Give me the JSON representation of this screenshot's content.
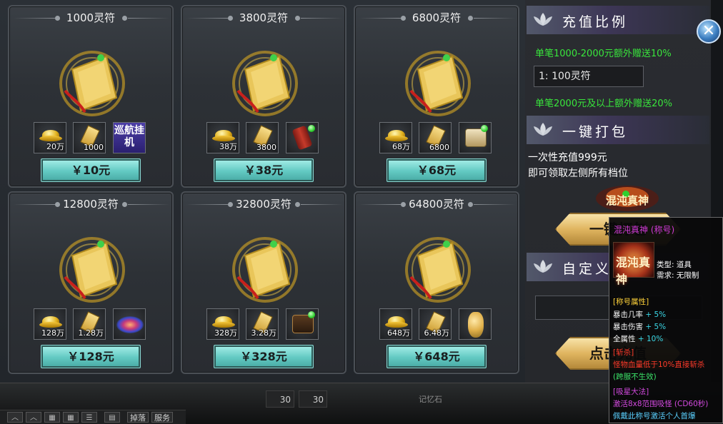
{
  "packs": [
    {
      "title": "1000灵符",
      "items": [
        {
          "icon": "gold-ingot",
          "count": "20万"
        },
        {
          "icon": "talisman-ticket",
          "count": "1000"
        },
        {
          "icon": "patrol-afk",
          "label": "巡航挂机"
        }
      ],
      "price": "￥10元"
    },
    {
      "title": "3800灵符",
      "items": [
        {
          "icon": "gold-ingot",
          "count": "38万"
        },
        {
          "icon": "talisman-ticket",
          "count": "3800"
        },
        {
          "icon": "red-scroll",
          "count": ""
        }
      ],
      "price": "￥38元"
    },
    {
      "title": "6800灵符",
      "items": [
        {
          "icon": "gold-ingot",
          "count": "68万"
        },
        {
          "icon": "talisman-ticket",
          "count": "6800"
        },
        {
          "icon": "treasure-chest",
          "count": ""
        }
      ],
      "price": "￥68元"
    },
    {
      "title": "12800灵符",
      "items": [
        {
          "icon": "gold-ingot",
          "count": "128万"
        },
        {
          "icon": "talisman-ticket",
          "count": "1.28万"
        },
        {
          "icon": "galaxy-effect",
          "count": ""
        }
      ],
      "price": "￥128元"
    },
    {
      "title": "32800灵符",
      "items": [
        {
          "icon": "gold-ingot",
          "count": "328万"
        },
        {
          "icon": "talisman-ticket",
          "count": "3.28万"
        },
        {
          "icon": "dark-chest",
          "count": ""
        }
      ],
      "price": "￥328元"
    },
    {
      "title": "64800灵符",
      "items": [
        {
          "icon": "gold-ingot",
          "count": "648万"
        },
        {
          "icon": "talisman-ticket",
          "count": "6.48万"
        },
        {
          "icon": "gourd-pet",
          "count": ""
        }
      ],
      "price": "￥648元"
    }
  ],
  "side": {
    "ratio_title": "充值比例",
    "bonus1": "单笔1000-2000元额外赠送10%",
    "rate_value": "1: 100灵符",
    "bonus2": "单笔2000元及以上额外赠送20%",
    "bundle_title": "一键打包",
    "bundle_desc1": "一次性充值999元",
    "bundle_desc2": "即可领取左侧所有档位",
    "bundle_button": "一键打包",
    "custom_title": "自定义",
    "custom_button": "点击充值",
    "banner_text": "混沌真神"
  },
  "tooltip": {
    "name": "混沌真神 (称号)",
    "icon_text": "混沌真神",
    "type": "类型: 道具",
    "require": "需求: 无限制",
    "attr_header": "[称号属性]",
    "attr1_label": "暴击几率",
    "attr1_value": "+ 5%",
    "attr2_label": "暴击伤害",
    "attr2_value": "+ 5%",
    "attr3_label": "全属性",
    "attr3_value": "+ 10%",
    "skill1_header": "[斩杀]",
    "skill1_desc": "怪物血量低于10%直接斩杀",
    "skill1_note": "(跨服不生效)",
    "skill2_header": "[吸星大法]",
    "skill2_desc": "激活8x8范围吸怪 (CD60秒)",
    "skill2_note": "佩戴此称号激活个人首爆"
  },
  "hud": {
    "slot1": "30",
    "slot2": "30",
    "memory_stone": "记忆石",
    "drop": "掉落",
    "service": "服务"
  },
  "colors": {
    "accent": "#62c9c2",
    "bonus_green": "#39e63c",
    "gold": "#e0b560",
    "tooltip_name": "#d23ad8"
  }
}
